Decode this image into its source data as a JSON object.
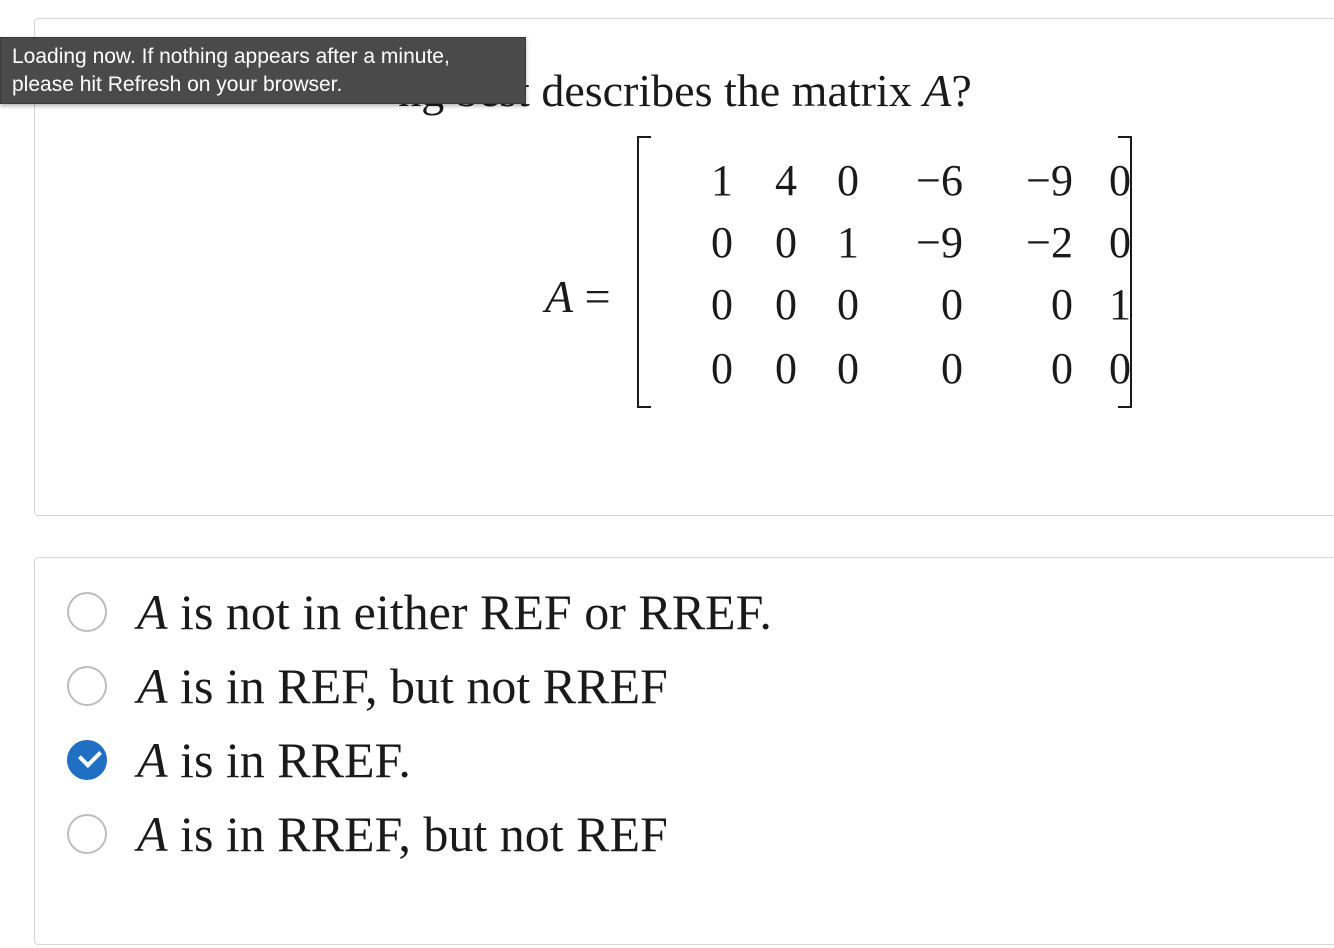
{
  "loading_tooltip": {
    "line1": "Loading now.  If nothing appears after a minute,",
    "line2": "please hit Refresh on your browser."
  },
  "question": {
    "text_visible": "ng best describes the matrix ",
    "variable": "A",
    "end": "?",
    "matrix_lhs_variable": "A",
    "matrix_lhs_equals": " =",
    "matrix": [
      [
        "1",
        "4",
        "0",
        "−6",
        "−9",
        "0"
      ],
      [
        "0",
        "0",
        "1",
        "−9",
        "−2",
        "0"
      ],
      [
        "0",
        "0",
        "0",
        "0",
        "0",
        "1"
      ],
      [
        "0",
        "0",
        "0",
        "0",
        "0",
        "0"
      ]
    ]
  },
  "options": [
    {
      "variable": "A",
      "text": " is not in either REF or RREF.",
      "selected": false
    },
    {
      "variable": "A",
      "text": " is in REF, but not RREF",
      "selected": false
    },
    {
      "variable": "A",
      "text": " is in RREF.",
      "selected": true
    },
    {
      "variable": "A",
      "text": " is in RREF, but not REF",
      "selected": false
    }
  ],
  "colors": {
    "selected_radio": "#1f6fc5",
    "tooltip_bg": "#4a4a4a",
    "panel_border": "#d6d6d6"
  },
  "icons": {
    "selected": "check-icon"
  }
}
